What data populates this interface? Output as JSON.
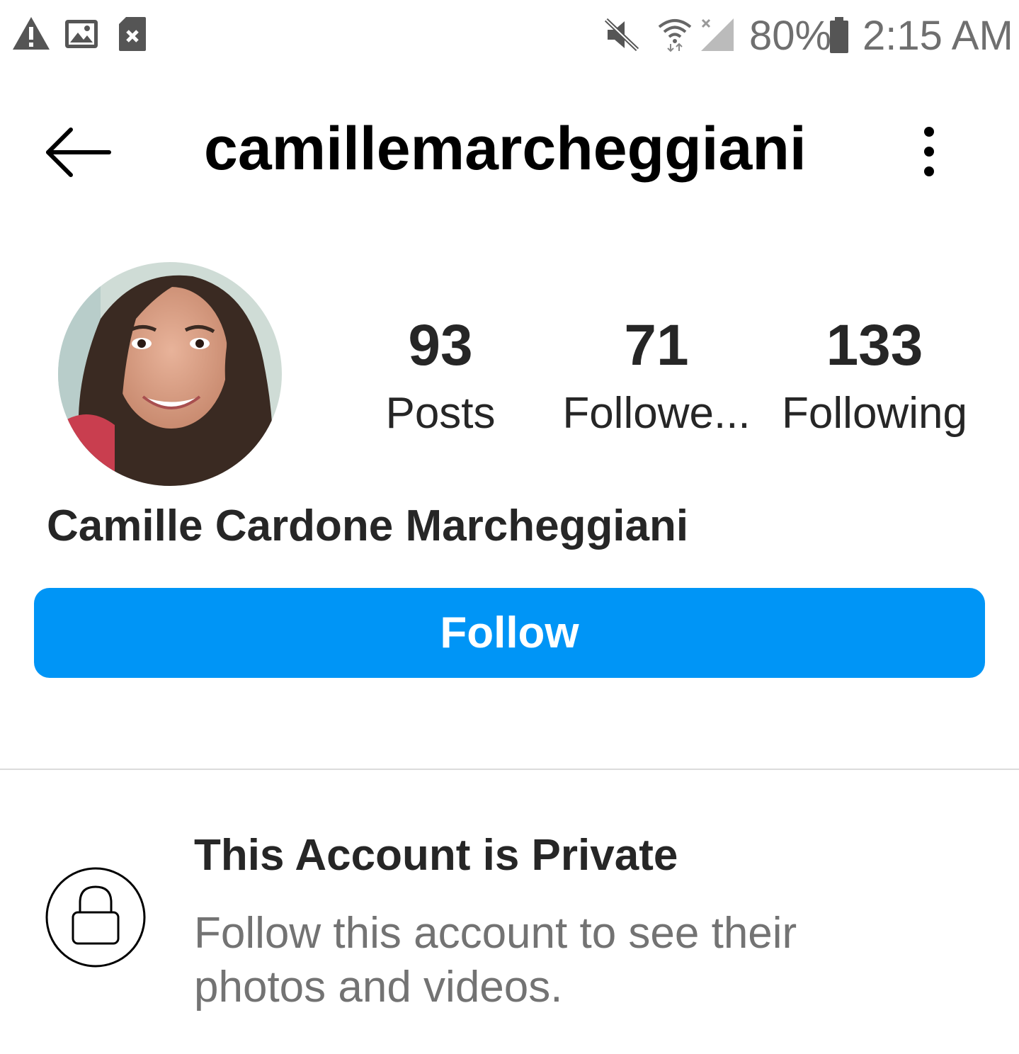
{
  "status_bar": {
    "left_icons": [
      "warning-icon",
      "image-icon",
      "sd-card-error-icon"
    ],
    "right_icons": [
      "mute-icon",
      "wifi-icon",
      "signal-icon",
      "battery-icon"
    ],
    "battery": "80%",
    "time": "2:15 AM"
  },
  "header": {
    "back_icon": "arrow-left-icon",
    "username": "camillemarcheggiani",
    "more_icon": "vertical-dots-icon"
  },
  "profile": {
    "stats": [
      {
        "count": "93",
        "label": "Posts"
      },
      {
        "count": "71",
        "label": "Followe..."
      },
      {
        "count": "133",
        "label": "Following"
      }
    ],
    "full_name": "Camille Cardone Marcheggiani",
    "follow_label": "Follow"
  },
  "private": {
    "lock_icon": "lock-icon",
    "title": "This Account is Private",
    "description": "Follow this account to see their photos and videos."
  },
  "colors": {
    "accent": "#0095f6",
    "text_primary": "#262626",
    "text_secondary": "#737373",
    "divider": "#dbdbdb"
  }
}
